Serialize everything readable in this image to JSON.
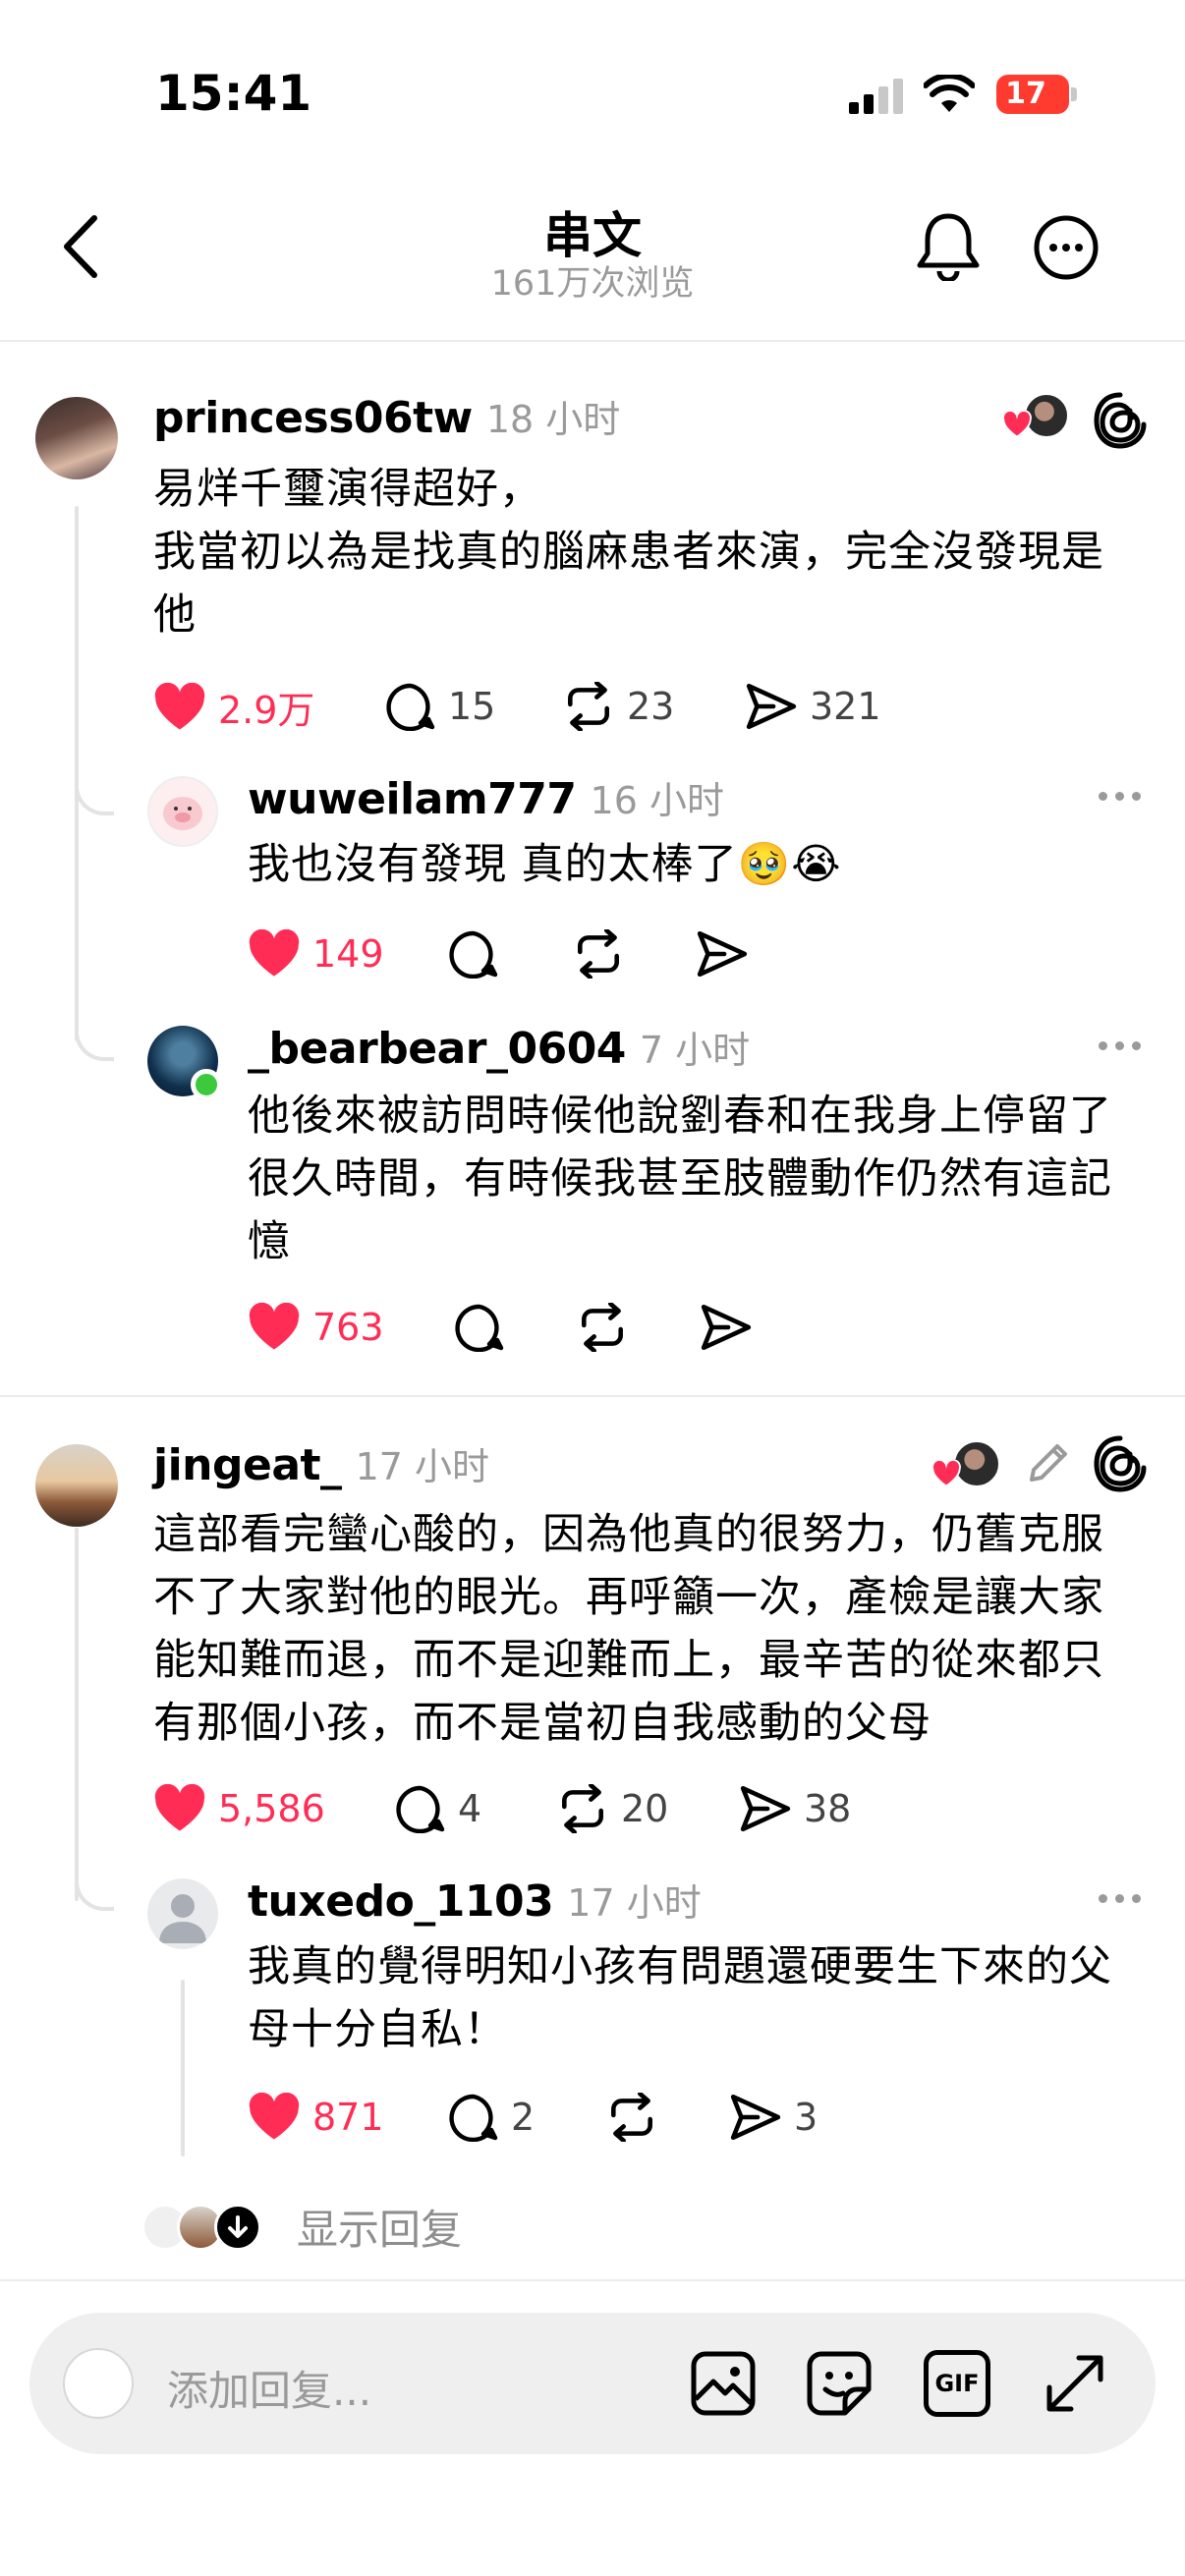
{
  "status_bar": {
    "time": "15:41",
    "battery": "17"
  },
  "header": {
    "title": "串文",
    "subtitle": "161万次浏览"
  },
  "comments": [
    {
      "username": "princess06tw",
      "time": "18 小时",
      "text": "易烊千璽演得超好，\n我當初以為是找真的腦麻患者來演，完全沒發現是他",
      "likes": "2.9万",
      "replies": "15",
      "reposts": "23",
      "shares": "321"
    },
    {
      "username": "wuweilam777",
      "time": "16 小时",
      "text": "我也沒有發現 真的太棒了🥹😭",
      "likes": "149"
    },
    {
      "username": "_bearbear_0604",
      "time": "7 小时",
      "text": "他後來被訪問時候他說劉春和在我身上停留了很久時間，有時候我甚至肢體動作仍然有這記憶",
      "likes": "763"
    },
    {
      "username": "jingeat_",
      "time": "17 小时",
      "text": "這部看完蠻心酸的，因為他真的很努力，仍舊克服不了大家對他的眼光。再呼籲一次，產檢是讓大家能知難而退，而不是迎難而上，最辛苦的從來都只有那個小孩，而不是當初自我感動的父母",
      "likes": "5,586",
      "replies": "4",
      "reposts": "20",
      "shares": "38"
    },
    {
      "username": "tuxedo_1103",
      "time": "17 小时",
      "text": "我真的覺得明知小孩有問題還硬要生下來的父母十分自私！",
      "likes": "871",
      "replies": "2",
      "shares": "3"
    }
  ],
  "show_replies": "显示回复",
  "composer": {
    "placeholder": "添加回复...",
    "gif_label": "GIF"
  },
  "colors": {
    "like": "#ff2d55",
    "muted": "#9a9a9a",
    "online": "#3cc93c"
  }
}
